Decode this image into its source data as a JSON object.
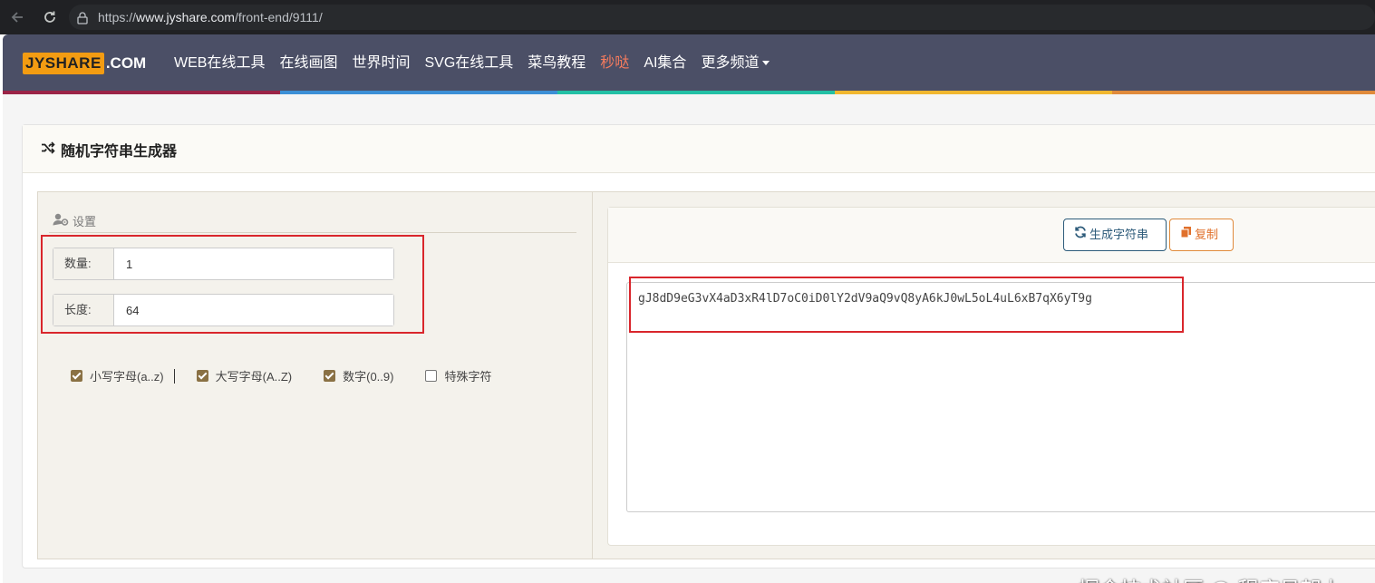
{
  "browser": {
    "url_prefix": "https://",
    "url_host": "www.jyshare.com",
    "url_path": "/front-end/9111/"
  },
  "site": {
    "logo_main": "JYSHARE",
    "logo_suffix": ".COM",
    "menu": [
      "WEB在线工具",
      "在线画图",
      "世界时间",
      "SVG在线工具",
      "菜鸟教程",
      "秒哒",
      "AI集合",
      "更多频道"
    ]
  },
  "tool": {
    "title": "随机字符串生成器",
    "settings_title": "设置",
    "count_label": "数量:",
    "count_value": "1",
    "length_label": "长度:",
    "length_value": "64",
    "options": [
      {
        "label": "小写字母(a..z)",
        "checked": true
      },
      {
        "label": "大写字母(A..Z)",
        "checked": true
      },
      {
        "label": "数字(0..9)",
        "checked": true
      },
      {
        "label": "特殊字符",
        "checked": false
      }
    ],
    "generate_label": "生成字符串",
    "copy_label": "复制",
    "output": "gJ8dD9eG3vX4aD3xR4lD7oC0iD0lY2dV9aQ9vQ8yA6kJ0wL5oL4uL6xB7qX6yT9g"
  },
  "watermark": "掘金技术社区 @ 程序员朝上",
  "colors": {
    "nav_bg": "#4b4f66",
    "highlight_menu": "#f47b5e",
    "checkbox": "#8a7144",
    "annotation": "#d9262c",
    "generate_button": "#2d5b7a",
    "copy_button": "#e08a3b"
  }
}
